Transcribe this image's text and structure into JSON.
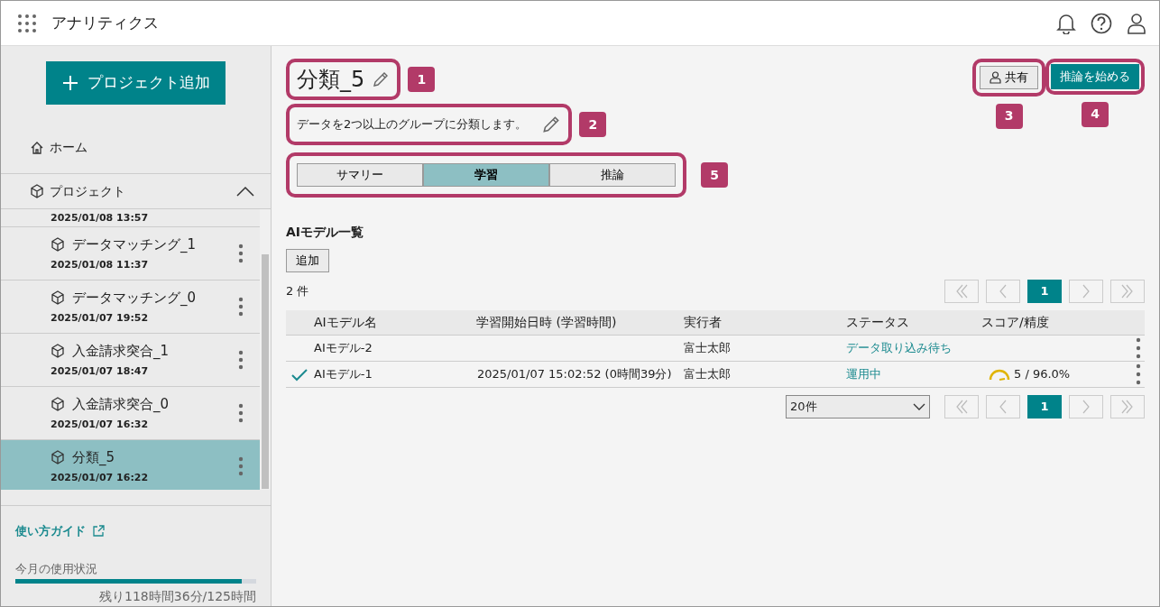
{
  "app": {
    "title": "アナリティクス"
  },
  "sidebar": {
    "add_button": "プロジェクト追加",
    "home": "ホーム",
    "projects_label": "プロジェクト",
    "projects_expanded": true,
    "partial_date": "2025/01/08 13:57",
    "projects": [
      {
        "name": "データマッチング_1",
        "date": "2025/01/08 11:37",
        "selected": false
      },
      {
        "name": "データマッチング_0",
        "date": "2025/01/07 19:52",
        "selected": false
      },
      {
        "name": "入金請求突合_1",
        "date": "2025/01/07 18:47",
        "selected": false
      },
      {
        "name": "入金請求突合_0",
        "date": "2025/01/07 16:32",
        "selected": false
      },
      {
        "name": "分類_5",
        "date": "2025/01/07 16:22",
        "selected": true
      }
    ],
    "guide_link": "使い方ガイド",
    "usage": {
      "label": "今月の使用状況",
      "level": 0.94,
      "reading": "残り118時間36分/125時間"
    }
  },
  "main": {
    "title": "分類_5",
    "description": "データを2つ以上のグループに分類します。",
    "share_button": "共有",
    "start_button": "推論を始める",
    "tabs": [
      {
        "label": "サマリー",
        "selected": false
      },
      {
        "label": "学習",
        "selected": true
      },
      {
        "label": "推論",
        "selected": false
      }
    ],
    "section_title": "AIモデル一覧",
    "add_button": "追加",
    "count": "2 件",
    "pages": [
      "1",
      "1"
    ],
    "page_size": "20件",
    "table": {
      "columns": [
        "AIモデル名",
        "学習開始日時 (学習時間)",
        "実行者",
        "ステータス",
        "スコア/精度"
      ],
      "rows": [
        {
          "selected": false,
          "name": "AIモデル-2",
          "user": "富士太郎",
          "status": "データ取り込み待ち"
        },
        {
          "selected": true,
          "name": "AIモデル-1",
          "start": "2025/01/07 15:02:52 (0時間39分)",
          "user": "富士太郎",
          "status": "運用中",
          "score": "5 / 96.0%"
        }
      ]
    }
  },
  "callouts": [
    "1",
    "2",
    "3",
    "4",
    "5"
  ]
}
